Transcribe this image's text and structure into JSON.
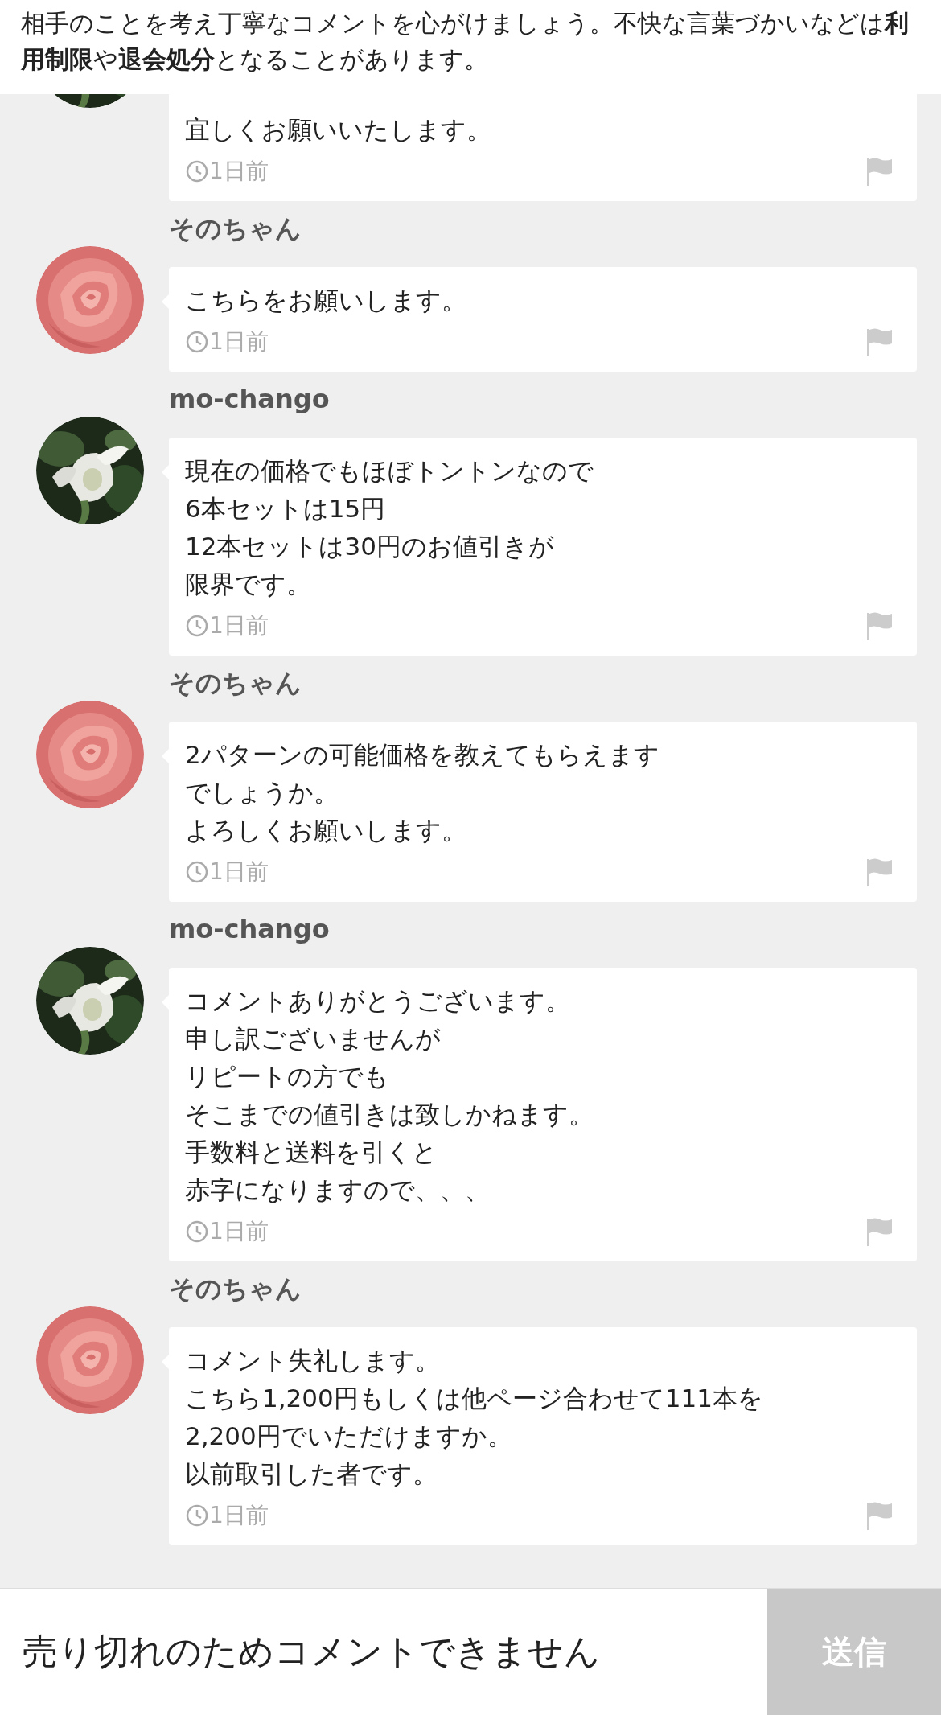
{
  "notice": "相手のことを考え丁寧なコメントを心がけましょう。不快な言葉づかいなどは**利用制限**や**退会処分**となることがあります。",
  "comments": [
    {
      "cut_top": true,
      "avatar": {
        "kind": "picture"
      },
      "lines": [
        "宜しくお願いいたします。"
      ],
      "time": "1日前"
    },
    {
      "cut_top": false,
      "user": "そのちゃん",
      "avatar": {
        "kind": "picture"
      },
      "lines": [
        "こちらをお願いします。"
      ],
      "time": "1日前"
    },
    {
      "cut_top": false,
      "user": "mo-chango",
      "avatar": {
        "kind": "picture"
      },
      "lines": [
        "現在の価格でもほぼトントンなので",
        "6本セットは15円",
        "12本セットは30円のお値引きが",
        "限界です。"
      ],
      "time": "1日前"
    },
    {
      "cut_top": false,
      "user": "そのちゃん",
      "avatar": {
        "kind": "picture"
      },
      "lines": [
        "2パターンの可能価格を教えてもらえます",
        "でしょうか。",
        "よろしくお願いします。"
      ],
      "time": "1日前"
    },
    {
      "cut_top": false,
      "user": "mo-chango",
      "avatar": {
        "kind": "picture"
      },
      "lines": [
        "コメントありがとうございます。",
        "申し訳ございませんが",
        "リピートの方でも",
        "そこまでの値引きは致しかねます。",
        "手数料と送料を引くと",
        "赤字になりますので、、、"
      ],
      "time": "1日前"
    },
    {
      "cut_top": false,
      "user": "そのちゃん",
      "avatar": {
        "kind": "picture"
      },
      "lines": [
        "コメント失礼します。",
        "こちら1,200円もしくは他ページ合わせて111本を",
        "2,200円でいただけますか。",
        "以前取引した者です。"
      ],
      "time": "1日前"
    }
  ],
  "comment_bar": {
    "message": "売り切れのためコメントできません",
    "send_button": {
      "label": "送信",
      "disabled": true
    }
  }
}
